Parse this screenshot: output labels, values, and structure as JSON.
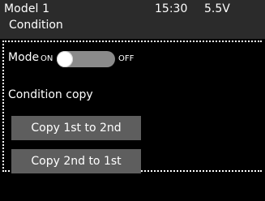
{
  "header": {
    "model": "Model 1",
    "time": "15:30",
    "voltage": "5.5V",
    "screen_title": "Condition"
  },
  "mode": {
    "label": "Mode",
    "on_label": "ON",
    "off_label": "OFF"
  },
  "condition_copy": {
    "label": "Condition copy",
    "copy_1_to_2": "Copy 1st to 2nd",
    "copy_2_to_1": "Copy 2nd to 1st"
  },
  "colors": {
    "header_bg": "#2b2b2b",
    "button_bg": "#5e5e5e",
    "toggle_track": "#8a8a8a"
  }
}
